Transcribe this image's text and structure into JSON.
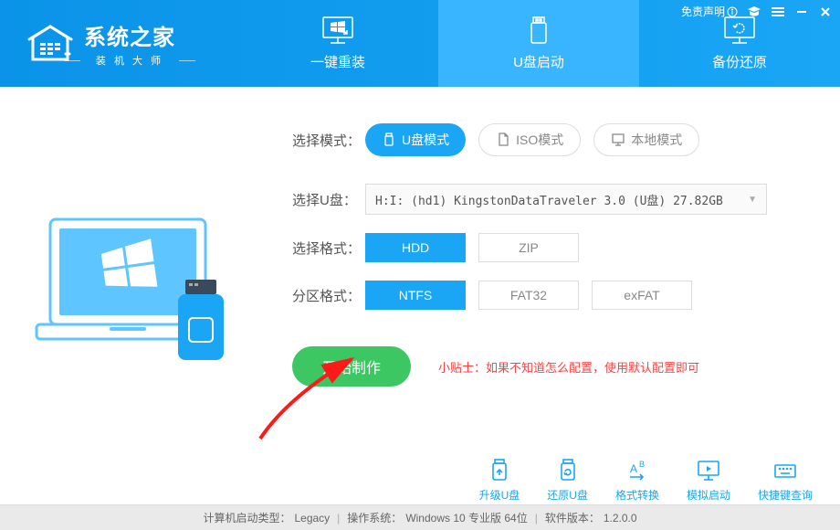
{
  "titlebar": {
    "disclaimer": "免责声明"
  },
  "logo": {
    "title": "系统之家",
    "sub": "装 机 大 师"
  },
  "tabs": [
    {
      "label": "一键重装",
      "name": "reinstall"
    },
    {
      "label": "U盘启动",
      "name": "usb-boot"
    },
    {
      "label": "备份还原",
      "name": "backup-restore"
    }
  ],
  "active_tab": 1,
  "mode": {
    "label": "选择模式：",
    "options": [
      {
        "label": "U盘模式",
        "name": "usb-mode",
        "active": true
      },
      {
        "label": "ISO模式",
        "name": "iso-mode",
        "active": false
      },
      {
        "label": "本地模式",
        "name": "local-mode",
        "active": false
      }
    ]
  },
  "usb_select": {
    "label": "选择U盘：",
    "value": "H:I: (hd1) KingstonDataTraveler 3.0 (U盘) 27.82GB"
  },
  "format": {
    "label": "选择格式：",
    "options": [
      "HDD",
      "ZIP"
    ],
    "active": 0
  },
  "partition": {
    "label": "分区格式：",
    "options": [
      "NTFS",
      "FAT32",
      "exFAT"
    ],
    "active": 0
  },
  "start": {
    "label": "开始制作",
    "tip_prefix": "小贴士：",
    "tip_text": "如果不知道怎么配置，使用默认配置即可"
  },
  "tools": [
    {
      "label": "升级U盘",
      "name": "upgrade-usb"
    },
    {
      "label": "还原U盘",
      "name": "restore-usb"
    },
    {
      "label": "格式转换",
      "name": "format-convert"
    },
    {
      "label": "模拟启动",
      "name": "simulate-boot"
    },
    {
      "label": "快捷键查询",
      "name": "hotkey-query"
    }
  ],
  "statusbar": {
    "boot_type_label": "计算机启动类型：",
    "boot_type": "Legacy",
    "os_label": "操作系统：",
    "os": "Windows 10 专业版 64位",
    "version_label": "软件版本：",
    "version": "1.2.0.0"
  }
}
